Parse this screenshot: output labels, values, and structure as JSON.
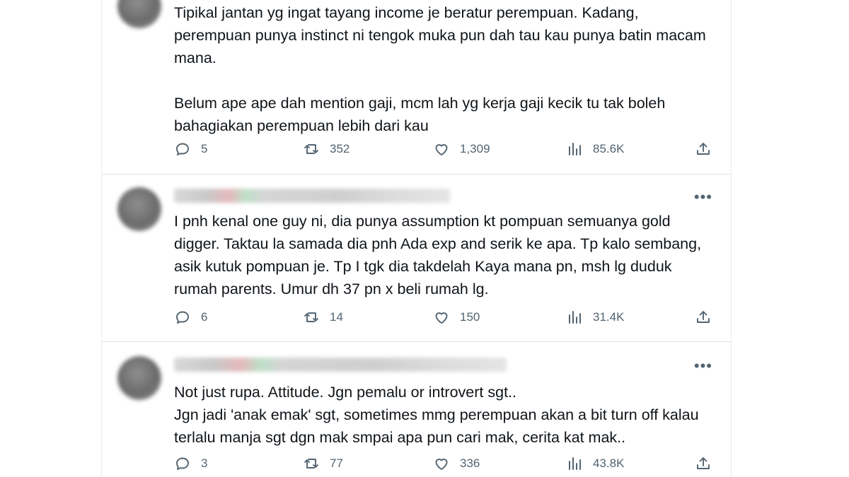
{
  "tweets": [
    {
      "text": "Tipikal jantan yg ingat tayang income je beratur perempuan. Kadang, perempuan punya instinct ni tengok muka pun dah tau kau punya batin macam mana.\n\nBelum ape ape dah mention gaji, mcm lah yg kerja gaji kecik tu tak boleh bahagiakan perempuan lebih dari kau",
      "replies": "5",
      "retweets": "352",
      "likes": "1,309",
      "views": "85.6K"
    },
    {
      "text": "I pnh kenal one guy ni, dia punya assumption kt pompuan semuanya gold digger. Taktau la samada dia pnh Ada exp and serik ke apa. Tp kalo sembang, asik kutuk pompuan je. Tp I tgk dia takdelah Kaya mana pn, msh lg duduk rumah parents. Umur dh 37 pn x beli rumah lg.",
      "replies": "6",
      "retweets": "14",
      "likes": "150",
      "views": "31.4K"
    },
    {
      "text": "Not just rupa. Attitude. Jgn pemalu or introvert sgt..\nJgn jadi 'anak emak' sgt, sometimes mmg perempuan akan a bit turn off kalau terlalu manja sgt dgn mak smpai apa pun cari mak, cerita kat mak..",
      "replies": "3",
      "retweets": "77",
      "likes": "336",
      "views": "43.8K"
    }
  ],
  "more_label": "•••",
  "icons": {
    "reply": "reply-icon",
    "retweet": "retweet-icon",
    "like": "like-icon",
    "views": "views-icon",
    "share": "share-icon",
    "more": "more-icon"
  },
  "colors": {
    "text": "#0f1419",
    "muted": "#536471",
    "border": "#dfe5ea"
  }
}
